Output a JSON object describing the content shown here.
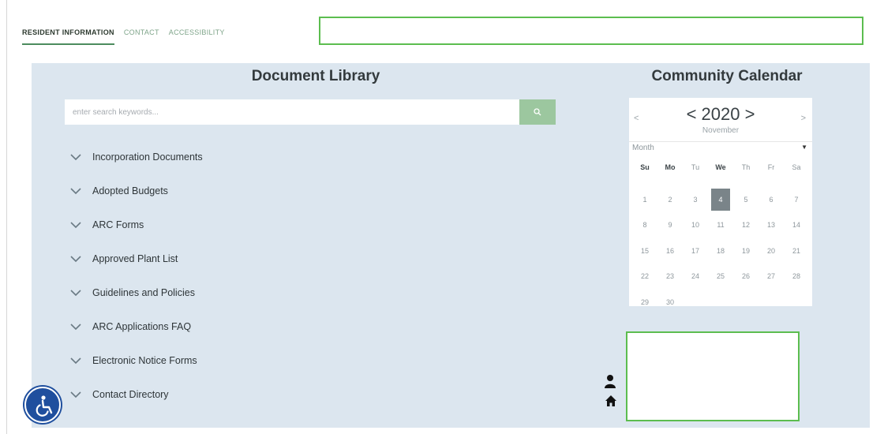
{
  "nav": {
    "items": [
      {
        "label": "RESIDENT INFORMATION",
        "active": true
      },
      {
        "label": "CONTACT",
        "active": false
      },
      {
        "label": "ACCESSIBILITY",
        "active": false
      }
    ]
  },
  "document_library": {
    "title": "Document Library",
    "search": {
      "placeholder": "enter search keywords...",
      "button_icon": "search-icon"
    },
    "items": [
      "Incorporation Documents",
      "Adopted Budgets",
      "ARC Forms",
      "Approved Plant List",
      "Guidelines and Policies",
      "ARC Applications FAQ",
      "Electronic Notice Forms",
      "Contact Directory"
    ]
  },
  "community_calendar": {
    "title": "Community Calendar",
    "prev": "<",
    "next": ">",
    "year_label": "< 2020 >",
    "month": "November",
    "view": "Month",
    "weekdays": [
      "Su",
      "Mo",
      "Tu",
      "We",
      "Th",
      "Fr",
      "Sa"
    ],
    "days": [
      "1",
      "2",
      "3",
      "4",
      "5",
      "6",
      "7",
      "8",
      "9",
      "10",
      "11",
      "12",
      "13",
      "14",
      "15",
      "16",
      "17",
      "18",
      "19",
      "20",
      "21",
      "22",
      "23",
      "24",
      "25",
      "26",
      "27",
      "28",
      "29",
      "30"
    ],
    "selected_day": "4"
  },
  "colors": {
    "accent_green": "#5cbd4f",
    "panel_bg": "#dce6ef",
    "accessibility_blue": "#1f4f9e"
  }
}
